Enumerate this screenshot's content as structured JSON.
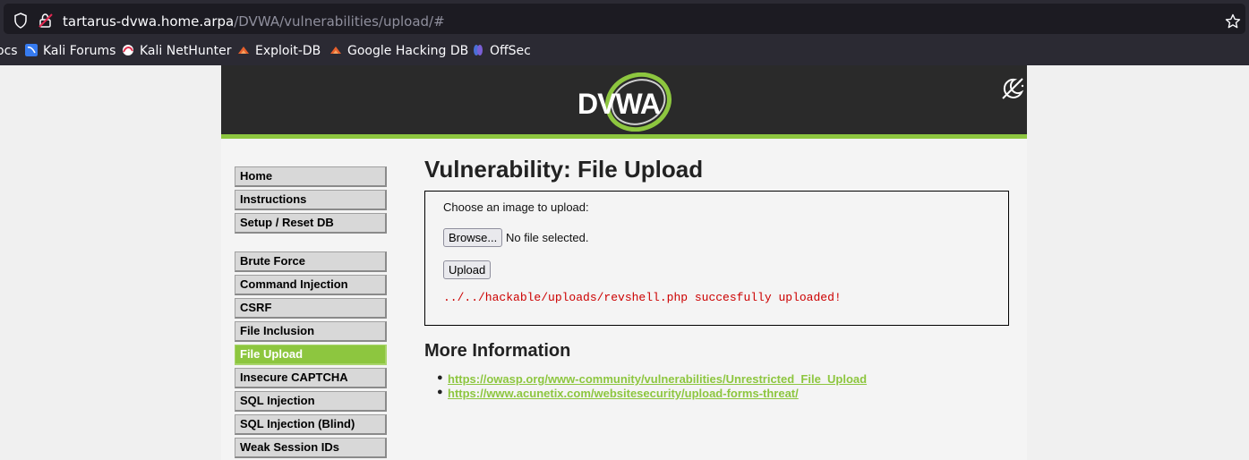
{
  "browser": {
    "url_host": "tartarus-dvwa.home.arpa",
    "url_path": "/DVWA/vulnerabilities/upload/#"
  },
  "bookmarks": [
    {
      "label": "ocs",
      "icon": "bookmark-icon"
    },
    {
      "label": "Kali Forums",
      "icon": "kali-forums-icon",
      "color": "#367bf0"
    },
    {
      "label": "Kali NetHunter",
      "icon": "kali-nethunter-icon",
      "color": "#e0304e"
    },
    {
      "label": "Exploit-DB",
      "icon": "exploit-db-icon",
      "color": "#e8602c"
    },
    {
      "label": "Google Hacking DB",
      "icon": "ghdb-icon",
      "color": "#e8602c"
    },
    {
      "label": "OffSec",
      "icon": "offsec-icon",
      "color": "#4a6fd6"
    }
  ],
  "dvwa": {
    "logo": "DVWA",
    "accent": "#8dc63f",
    "menu_group1": [
      "Home",
      "Instructions",
      "Setup / Reset DB"
    ],
    "menu_group2": [
      "Brute Force",
      "Command Injection",
      "CSRF",
      "File Inclusion",
      "File Upload",
      "Insecure CAPTCHA",
      "SQL Injection",
      "SQL Injection (Blind)",
      "Weak Session IDs"
    ],
    "active_menu": "File Upload",
    "title": "Vulnerability: File Upload",
    "upload_form": {
      "label": "Choose an image to upload:",
      "browse_label": "Browse...",
      "no_file_text": "No file selected.",
      "upload_label": "Upload",
      "result": "../../hackable/uploads/revshell.php succesfully uploaded!"
    },
    "more_info_title": "More Information",
    "links": [
      "https://owasp.org/www-community/vulnerabilities/Unrestricted_File_Upload",
      "https://www.acunetix.com/websitesecurity/upload-forms-threat/"
    ]
  }
}
